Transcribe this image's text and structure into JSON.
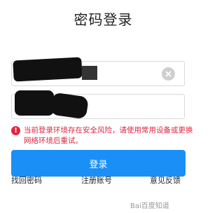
{
  "header": {
    "title": "密码登录"
  },
  "form": {
    "username": {
      "value": ""
    },
    "password": {
      "value": ""
    }
  },
  "warning": {
    "text": "当前登录环境存在安全风险，请使用常用设备或更换网络环境后重试。"
  },
  "login_button": {
    "label": "登录"
  },
  "links": {
    "find_password": "找回密码",
    "register": "注册账号",
    "feedback": "意见反馈"
  },
  "watermark": "Bai百度知道"
}
